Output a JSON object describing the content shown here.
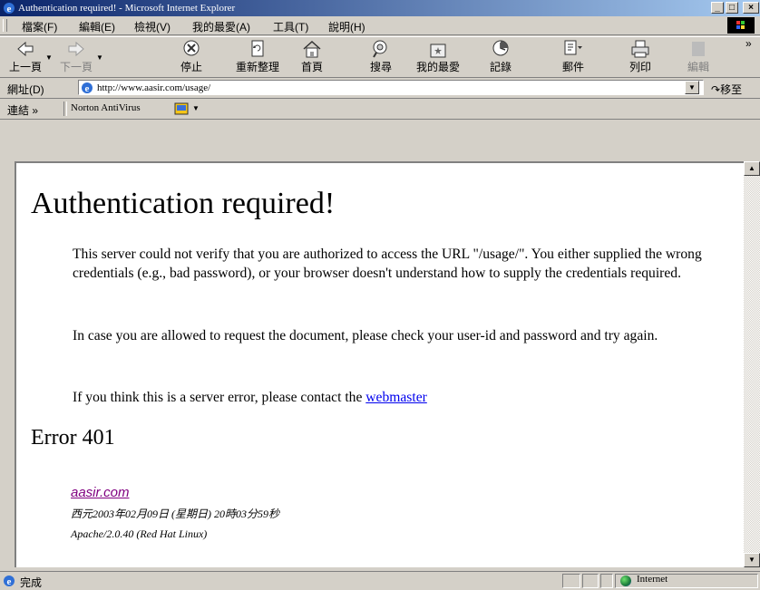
{
  "window": {
    "title": "Authentication required! - Microsoft Internet Explorer"
  },
  "menu": {
    "items": [
      "檔案(F)",
      "編輯(E)",
      "檢視(V)",
      "我的最愛(A)",
      "工具(T)",
      "說明(H)"
    ]
  },
  "toolbar": {
    "back": "上一頁",
    "forward": "下一頁",
    "stop": "停止",
    "refresh": "重新整理",
    "home": "首頁",
    "search": "搜尋",
    "favorites": "我的最愛",
    "history": "記錄",
    "mail": "郵件",
    "print": "列印",
    "edit": "編輯",
    "more": "»"
  },
  "address": {
    "label": "網址(D)",
    "url": "http://www.aasir.com/usage/",
    "go": "移至"
  },
  "links": {
    "label": "連結 »",
    "item": "Norton AntiVirus"
  },
  "page": {
    "heading": "Authentication required!",
    "p1": "This server could not verify that you are authorized to access the URL \"/usage/\". You either supplied the wrong credentials (e.g., bad password), or your browser doesn't understand how to supply the credentials required.",
    "p2": "In case you are allowed to request the document, please check your user-id and password and try again.",
    "p3_prefix": "If you think this is a server error, please contact the ",
    "p3_link": "webmaster",
    "error_heading": "Error 401",
    "address_link": "aasir.com",
    "address_date": "西元2003年02月09日 (星期日) 20時03分59秒",
    "address_server": "Apache/2.0.40 (Red Hat Linux)"
  },
  "status": {
    "text": "完成",
    "zone": "Internet"
  }
}
